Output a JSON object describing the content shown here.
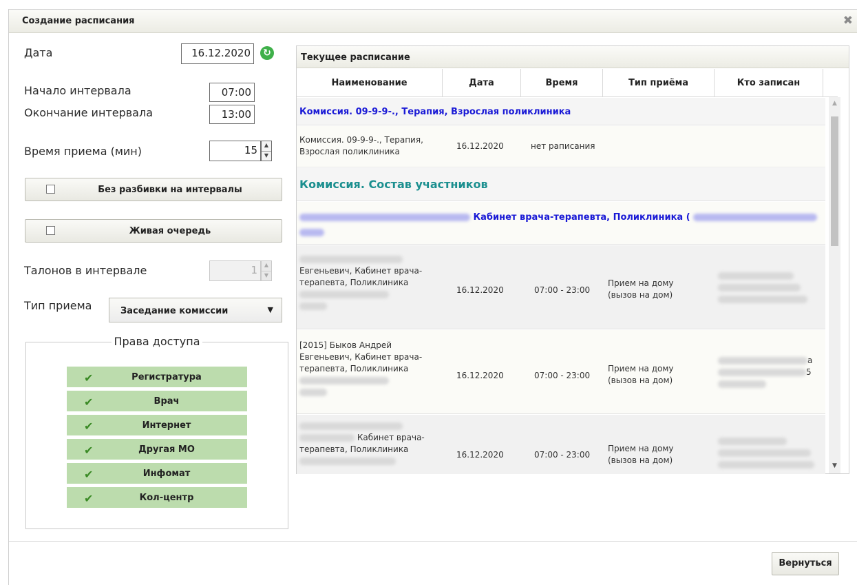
{
  "dialog": {
    "title": "Создание расписания",
    "close_icon": "close-icon"
  },
  "form": {
    "date_label": "Дата",
    "date_value": "16.12.2020",
    "start_label": "Начало интервала",
    "start_value": "07:00",
    "end_label": "Окончание интервала",
    "end_value": "13:00",
    "duration_label": "Время приема (мин)",
    "duration_value": "15",
    "no_split_label": "Без разбивки на интервалы",
    "live_queue_label": "Живая очередь",
    "tickets_label": "Талонов в интервале",
    "tickets_value": "1",
    "type_label": "Тип приема",
    "type_value": "Заседание комиссии"
  },
  "rights": {
    "legend": "Права доступа",
    "items": [
      {
        "label": "Регистратура",
        "checked": true
      },
      {
        "label": "Врач",
        "checked": true
      },
      {
        "label": "Интернет",
        "checked": true
      },
      {
        "label": "Другая МО",
        "checked": true
      },
      {
        "label": "Инфомат",
        "checked": true
      },
      {
        "label": "Кол-центр",
        "checked": true
      }
    ],
    "check_color": "#3a8a25",
    "row_color": "#bcdcad"
  },
  "schedule": {
    "title": "Текущее расписание",
    "columns": [
      "Наименование",
      "Дата",
      "Время",
      "Тип приёма",
      "Кто записан"
    ],
    "group_header": "Комиссия. 09-9-9-., Терапия, Взрослая поликлиника",
    "row1": {
      "name_line1": "Комиссия. 09-9-9-., Терапия,",
      "name_line2": "Взрослая поликлиника",
      "date": "16.12.2020",
      "time": "нет рaписания"
    },
    "section_title": "Комиссия. Состав участников",
    "subgroup_header": "Кабинет врача-терапевта, Поликлиника (",
    "row2": {
      "name_line1": "Евгеньевич, Кабинет врача-",
      "name_line2": "терапевта, Поликлиника",
      "date": "16.12.2020",
      "time": "07:00 - 23:00",
      "type_line1": "Прием на дому",
      "type_line2": "(вызов на дом)"
    },
    "row3": {
      "name_line0": "[2015] Быков Андрей",
      "name_line1": "Евгеньевич, Кабинет врача-",
      "name_line2": "терапевта, Поликлиника",
      "date": "16.12.2020",
      "time": "07:00 - 23:00",
      "type_line1": "Прием на дому",
      "type_line2": "(вызов на дом)",
      "who_tail1": "а",
      "who_tail2": "5"
    },
    "row4": {
      "name_line1": "Кабинет врача-",
      "name_line2": "терапевта, Поликлиника",
      "date": "16.12.2020",
      "time": "07:00 - 23:00",
      "type_line1": "Прием на дому",
      "type_line2": "(вызов на дом)"
    },
    "link_color": "#1a1ad6",
    "section_color": "#1b8f8f"
  },
  "footer": {
    "back_label": "Вернуться"
  }
}
